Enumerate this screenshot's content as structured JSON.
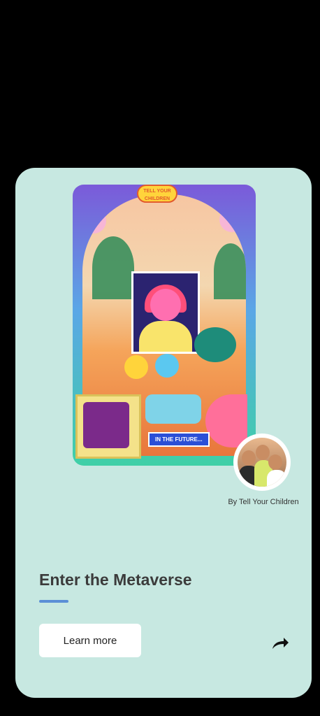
{
  "card": {
    "art": {
      "logo_text": "TELL YOUR CHILDREN",
      "caption": "IN THE FUTURE..."
    },
    "byline": "By Tell Your Children",
    "title": "Enter the Metaverse",
    "learn_more": "Learn more"
  },
  "colors": {
    "background": "#000000",
    "card": "#c7e8e1",
    "accent_underline": "#5b8fd6"
  },
  "icons": {
    "share": "share-arrow-icon",
    "avatar": "author-avatar"
  }
}
